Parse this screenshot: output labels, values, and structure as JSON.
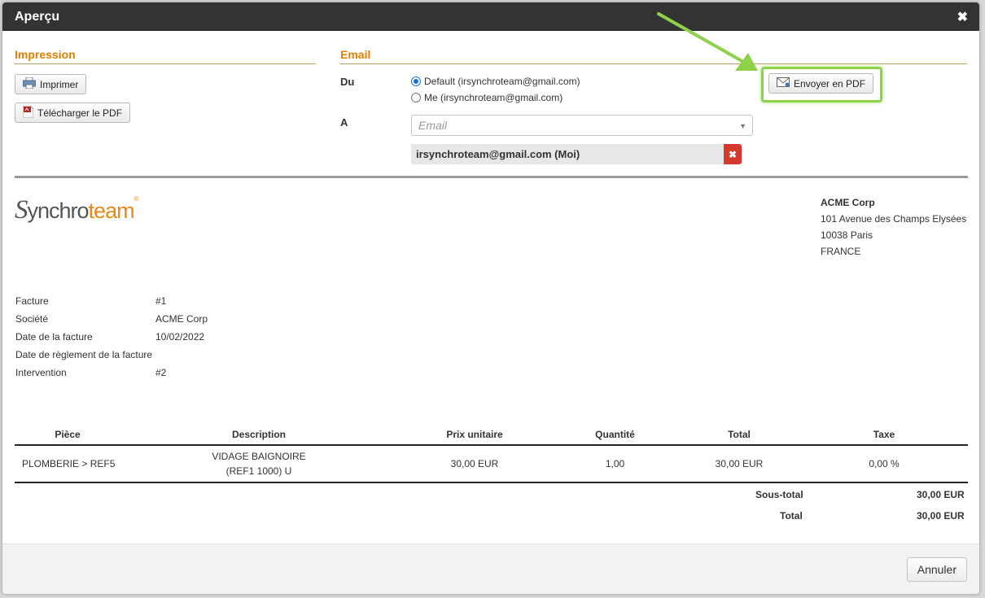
{
  "modal": {
    "title": "Aperçu",
    "close_glyph": "✖"
  },
  "impression": {
    "heading": "Impression",
    "print_label": "Imprimer",
    "download_label": "Télécharger le PDF"
  },
  "email": {
    "heading": "Email",
    "from_label": "Du",
    "from_options": [
      {
        "label": "Default (irsynchroteam@gmail.com)",
        "selected": true
      },
      {
        "label": "Me (irsynchroteam@gmail.com)",
        "selected": false
      }
    ],
    "to_label": "A",
    "to_placeholder": "Email",
    "recipient_chip": "irsynchroteam@gmail.com (Moi)",
    "send_label": "Envoyer en PDF"
  },
  "logo": {
    "part1": "S",
    "part2": "ynchro",
    "part3": "team",
    "reg": "®"
  },
  "customer": {
    "name": "ACME Corp",
    "street": "101 Avenue des Champs Elysées",
    "city": "10038 Paris",
    "country": "FRANCE"
  },
  "invoice_meta": [
    {
      "key": "Facture",
      "value": "#1"
    },
    {
      "key": "Société",
      "value": "ACME Corp"
    },
    {
      "key": "Date de la facture",
      "value": "10/02/2022"
    },
    {
      "key": "Date de règlement de la facture",
      "value": ""
    },
    {
      "key": "Intervention",
      "value": "#2"
    }
  ],
  "table": {
    "headers": [
      "Pièce",
      "Description",
      "Prix unitaire",
      "Quantité",
      "Total",
      "Taxe"
    ],
    "rows": [
      [
        "PLOMBERIE > REF5",
        "VIDAGE BAIGNOIRE (REF1 1000) U",
        "30,00 EUR",
        "1,00",
        "30,00 EUR",
        "0,00 %"
      ]
    ]
  },
  "summary": {
    "subtotal_label": "Sous-total",
    "subtotal_value": "30,00 EUR",
    "total_label": "Total",
    "total_value": "30,00 EUR"
  },
  "footer": {
    "cancel_label": "Annuler"
  },
  "colors": {
    "accent_orange": "#e08000",
    "highlight_green": "#8ed14a",
    "remove_red": "#d63a2f"
  }
}
